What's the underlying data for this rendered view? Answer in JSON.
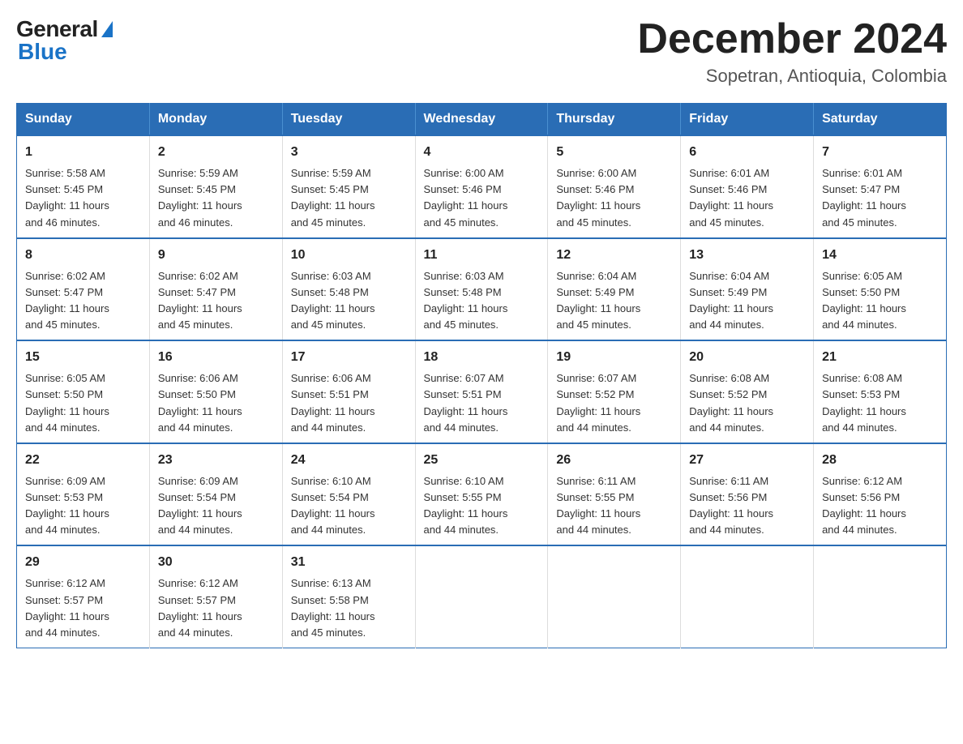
{
  "logo": {
    "general": "General",
    "blue": "Blue"
  },
  "title": "December 2024",
  "subtitle": "Sopetran, Antioquia, Colombia",
  "days_of_week": [
    "Sunday",
    "Monday",
    "Tuesday",
    "Wednesday",
    "Thursday",
    "Friday",
    "Saturday"
  ],
  "weeks": [
    [
      {
        "day": "1",
        "sunrise": "5:58 AM",
        "sunset": "5:45 PM",
        "daylight": "11 hours and 46 minutes."
      },
      {
        "day": "2",
        "sunrise": "5:59 AM",
        "sunset": "5:45 PM",
        "daylight": "11 hours and 46 minutes."
      },
      {
        "day": "3",
        "sunrise": "5:59 AM",
        "sunset": "5:45 PM",
        "daylight": "11 hours and 45 minutes."
      },
      {
        "day": "4",
        "sunrise": "6:00 AM",
        "sunset": "5:46 PM",
        "daylight": "11 hours and 45 minutes."
      },
      {
        "day": "5",
        "sunrise": "6:00 AM",
        "sunset": "5:46 PM",
        "daylight": "11 hours and 45 minutes."
      },
      {
        "day": "6",
        "sunrise": "6:01 AM",
        "sunset": "5:46 PM",
        "daylight": "11 hours and 45 minutes."
      },
      {
        "day": "7",
        "sunrise": "6:01 AM",
        "sunset": "5:47 PM",
        "daylight": "11 hours and 45 minutes."
      }
    ],
    [
      {
        "day": "8",
        "sunrise": "6:02 AM",
        "sunset": "5:47 PM",
        "daylight": "11 hours and 45 minutes."
      },
      {
        "day": "9",
        "sunrise": "6:02 AM",
        "sunset": "5:47 PM",
        "daylight": "11 hours and 45 minutes."
      },
      {
        "day": "10",
        "sunrise": "6:03 AM",
        "sunset": "5:48 PM",
        "daylight": "11 hours and 45 minutes."
      },
      {
        "day": "11",
        "sunrise": "6:03 AM",
        "sunset": "5:48 PM",
        "daylight": "11 hours and 45 minutes."
      },
      {
        "day": "12",
        "sunrise": "6:04 AM",
        "sunset": "5:49 PM",
        "daylight": "11 hours and 45 minutes."
      },
      {
        "day": "13",
        "sunrise": "6:04 AM",
        "sunset": "5:49 PM",
        "daylight": "11 hours and 44 minutes."
      },
      {
        "day": "14",
        "sunrise": "6:05 AM",
        "sunset": "5:50 PM",
        "daylight": "11 hours and 44 minutes."
      }
    ],
    [
      {
        "day": "15",
        "sunrise": "6:05 AM",
        "sunset": "5:50 PM",
        "daylight": "11 hours and 44 minutes."
      },
      {
        "day": "16",
        "sunrise": "6:06 AM",
        "sunset": "5:50 PM",
        "daylight": "11 hours and 44 minutes."
      },
      {
        "day": "17",
        "sunrise": "6:06 AM",
        "sunset": "5:51 PM",
        "daylight": "11 hours and 44 minutes."
      },
      {
        "day": "18",
        "sunrise": "6:07 AM",
        "sunset": "5:51 PM",
        "daylight": "11 hours and 44 minutes."
      },
      {
        "day": "19",
        "sunrise": "6:07 AM",
        "sunset": "5:52 PM",
        "daylight": "11 hours and 44 minutes."
      },
      {
        "day": "20",
        "sunrise": "6:08 AM",
        "sunset": "5:52 PM",
        "daylight": "11 hours and 44 minutes."
      },
      {
        "day": "21",
        "sunrise": "6:08 AM",
        "sunset": "5:53 PM",
        "daylight": "11 hours and 44 minutes."
      }
    ],
    [
      {
        "day": "22",
        "sunrise": "6:09 AM",
        "sunset": "5:53 PM",
        "daylight": "11 hours and 44 minutes."
      },
      {
        "day": "23",
        "sunrise": "6:09 AM",
        "sunset": "5:54 PM",
        "daylight": "11 hours and 44 minutes."
      },
      {
        "day": "24",
        "sunrise": "6:10 AM",
        "sunset": "5:54 PM",
        "daylight": "11 hours and 44 minutes."
      },
      {
        "day": "25",
        "sunrise": "6:10 AM",
        "sunset": "5:55 PM",
        "daylight": "11 hours and 44 minutes."
      },
      {
        "day": "26",
        "sunrise": "6:11 AM",
        "sunset": "5:55 PM",
        "daylight": "11 hours and 44 minutes."
      },
      {
        "day": "27",
        "sunrise": "6:11 AM",
        "sunset": "5:56 PM",
        "daylight": "11 hours and 44 minutes."
      },
      {
        "day": "28",
        "sunrise": "6:12 AM",
        "sunset": "5:56 PM",
        "daylight": "11 hours and 44 minutes."
      }
    ],
    [
      {
        "day": "29",
        "sunrise": "6:12 AM",
        "sunset": "5:57 PM",
        "daylight": "11 hours and 44 minutes."
      },
      {
        "day": "30",
        "sunrise": "6:12 AM",
        "sunset": "5:57 PM",
        "daylight": "11 hours and 44 minutes."
      },
      {
        "day": "31",
        "sunrise": "6:13 AM",
        "sunset": "5:58 PM",
        "daylight": "11 hours and 45 minutes."
      },
      null,
      null,
      null,
      null
    ]
  ],
  "labels": {
    "sunrise": "Sunrise:",
    "sunset": "Sunset:",
    "daylight": "Daylight:"
  },
  "colors": {
    "header_bg": "#2a6db5",
    "header_text": "#ffffff",
    "border": "#2a6db5",
    "accent_blue": "#1a73c7"
  }
}
